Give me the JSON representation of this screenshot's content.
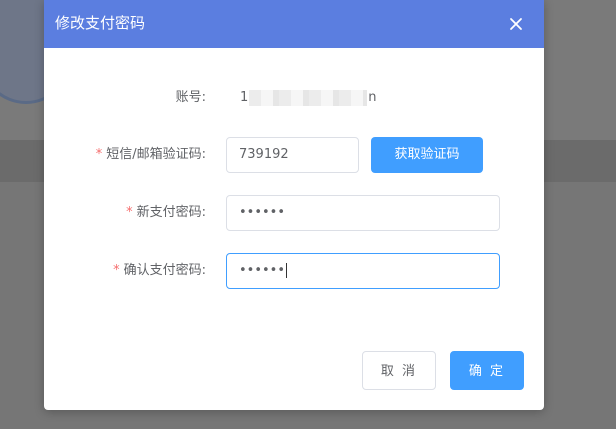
{
  "dialog": {
    "title": "修改支付密码",
    "close_icon": "close-icon"
  },
  "form": {
    "account": {
      "label": "账号:",
      "value_prefix": "1",
      "value_suffix": "n"
    },
    "sms_code": {
      "required_mark": "*",
      "label": "短信/邮箱验证码:",
      "value": "739192",
      "send_button": "获取验证码"
    },
    "new_password": {
      "required_mark": "*",
      "label": "新支付密码:",
      "value": "••••••"
    },
    "confirm_password": {
      "required_mark": "*",
      "label": "确认支付密码:",
      "value": "••••••"
    }
  },
  "footer": {
    "cancel_label": "取 消",
    "confirm_label": "确 定"
  },
  "colors": {
    "header": "#5b7ee0",
    "primary": "#409eff",
    "required": "#f56c6c",
    "overlay": "#767676"
  }
}
